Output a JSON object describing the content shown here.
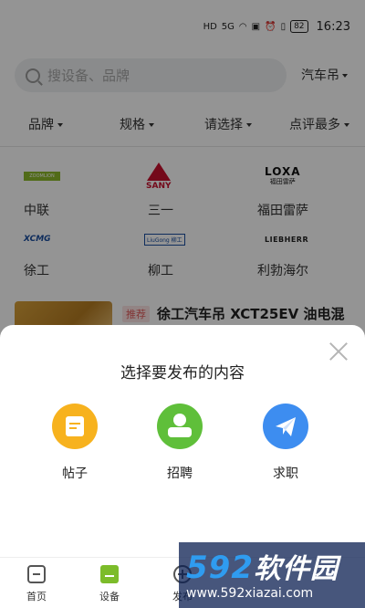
{
  "status_bar": {
    "battery": "82",
    "time": "16:23",
    "hd": "HD",
    "signal": "5G"
  },
  "search": {
    "placeholder": "搜设备、品牌",
    "city": "汽车吊"
  },
  "filters": [
    {
      "label": "品牌"
    },
    {
      "label": "规格"
    },
    {
      "label": "请选择"
    },
    {
      "label": "点评最多"
    }
  ],
  "brands": [
    {
      "name": "中联",
      "logo_text": "ZOOMLION",
      "icon": "zoomlion-logo"
    },
    {
      "name": "三一",
      "logo_text": "SANY",
      "icon": "sany-logo"
    },
    {
      "name": "福田雷萨",
      "logo_text": "LOXA",
      "logo_sub": "福田雷萨",
      "icon": "loxa-logo"
    },
    {
      "name": "徐工",
      "logo_text": "XCMG",
      "icon": "xcmg-logo"
    },
    {
      "name": "柳工",
      "logo_text": "LiuGong 柳工",
      "icon": "liugong-logo"
    },
    {
      "name": "利勃海尔",
      "logo_text": "LIEBHERR",
      "icon": "liebherr-logo"
    }
  ],
  "listing": {
    "tag": "推荐",
    "title": "徐工汽车吊 XCT25EV 油电混"
  },
  "sheet": {
    "title": "选择要发布的内容",
    "options": [
      {
        "label": "帖子",
        "icon": "post-icon",
        "color": "#f7b21e"
      },
      {
        "label": "招聘",
        "icon": "recruit-icon",
        "color": "#5fbf3a"
      },
      {
        "label": "求职",
        "icon": "paper-plane-icon",
        "color": "#3d8df0"
      }
    ]
  },
  "nav": [
    {
      "label": "首页",
      "icon": "home-icon"
    },
    {
      "label": "设备",
      "icon": "equipment-icon",
      "active": true
    },
    {
      "label": "发布",
      "icon": "publish-icon"
    }
  ],
  "watermark": {
    "brand_num": "592",
    "brand_cn": "软件园",
    "url": "www.592xiazai.com"
  }
}
